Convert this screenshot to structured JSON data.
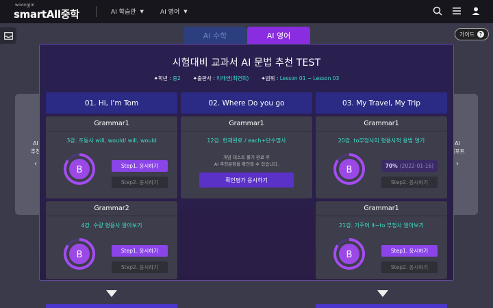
{
  "header": {
    "logo_small": "woongjin",
    "logo_main": "smartAll",
    "logo_suffix": "중학",
    "nav": [
      {
        "label": "AI 학습관"
      },
      {
        "label": "AI 영어"
      }
    ],
    "icons": [
      "search-icon",
      "menu-icon",
      "user-icon"
    ]
  },
  "tabs": [
    {
      "label": "AI 수학",
      "active": false
    },
    {
      "label": "AI 영어",
      "active": true
    }
  ],
  "guide": {
    "label": "가이드",
    "icon": "?"
  },
  "side_left": {
    "line1": "AI",
    "line2": "추천",
    "arrow": "‹"
  },
  "side_right": {
    "line1": "AI",
    "line2": "리포트",
    "arrow": "›"
  },
  "main": {
    "title": "시험대비 교과서 AI 문법 추천 TEST",
    "meta": [
      {
        "key": "✦학년 :",
        "value": "중2"
      },
      {
        "key": "✦출판사 :",
        "value": "미래엔(최연희)"
      },
      {
        "key": "✦범위 :",
        "value": "Lesson 01 ~ Lesson 03"
      }
    ]
  },
  "columns": [
    {
      "title": "01. Hi, I'm Tom",
      "cards": [
        {
          "title": "Grammar1",
          "lesson": "3강. 조동사 will, would/ will, would",
          "grade": "B",
          "progress": 0.85,
          "step1": "Step1. 응시하기",
          "step2": "Step2. 응시하기"
        },
        {
          "title": "Grammar2",
          "lesson": "4강. 수량 형용사 알아보기",
          "grade": "B",
          "progress": 0.85,
          "step1": "Step1. 응시하기",
          "step2": "Step2. 응시하기"
        }
      ]
    },
    {
      "title": "02. Where Do you go",
      "cards": [
        {
          "title": "Grammar1",
          "lesson": "12강. 현재완료 / each+단수명사",
          "note_line1": "개념 테스트 풀기 완료 후",
          "note_line2": "AI 추천문항을 확인할 수 있습니다.",
          "button": "확인평가 응시하기"
        }
      ]
    },
    {
      "title": "03. My Travel, My Trip",
      "cards": [
        {
          "title": "Grammar1",
          "lesson": "20강. to부정사의 형용사적 용법 알기",
          "grade": "B",
          "progress": 0.85,
          "score": "70%",
          "score_date": "(2022-01-16)",
          "step2": "Step2. 응시하기"
        },
        {
          "title": "Grammar1",
          "lesson": "21강. 가주어 it~to 부정사 알아보기",
          "grade": "B",
          "progress": 0.85,
          "step1": "Step1. 응시하기",
          "step2": "Step2. 응시하기"
        }
      ]
    }
  ],
  "colors": {
    "accent": "#8a44e8",
    "teal": "#3fe0c8",
    "header_bg": "#2b2b85"
  }
}
